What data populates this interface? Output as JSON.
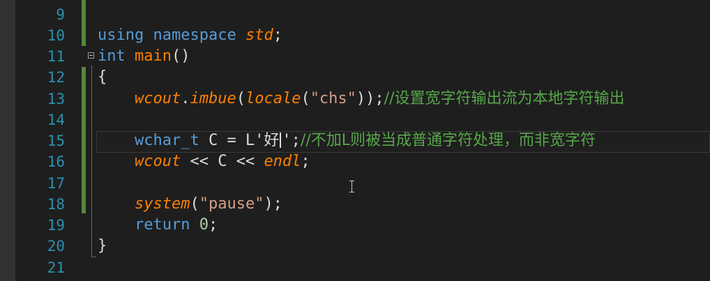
{
  "editor": {
    "language": "C++",
    "theme_colors": {
      "background": "#1e1e1e",
      "line_number": "#2b91af",
      "keyword": "#569cd6",
      "function": "#ff8000",
      "string": "#d69d85",
      "comment": "#57a64a",
      "number": "#b5cea8",
      "change_bar": "#55883a"
    },
    "current_line": 15,
    "lines": [
      {
        "number": "9"
      },
      {
        "number": "10",
        "t1": "using",
        "t2": " ",
        "t3": "namespace",
        "t4": " ",
        "t5": "std",
        "t6": ";"
      },
      {
        "number": "11",
        "t1": "int",
        "t2": " ",
        "t3": "main",
        "t4": "()"
      },
      {
        "number": "12",
        "t1": "{"
      },
      {
        "number": "13",
        "t1": "    ",
        "t2": "wcout",
        "t3": ".",
        "t4": "imbue",
        "t5": "(",
        "t6": "locale",
        "t7": "(",
        "t8": "\"chs\"",
        "t9": "));",
        "t10": "//设置宽字符输出流为本地字符输出"
      },
      {
        "number": "14"
      },
      {
        "number": "15",
        "t1": "    ",
        "t2": "wchar_t",
        "t3": " C = L'好",
        "t4": "';",
        "t5": "//不加L则被当成普通字符处理，而非宽字符"
      },
      {
        "number": "16",
        "t1": "    ",
        "t2": "wcout",
        "t3": " << C << ",
        "t4": "endl",
        "t5": ";"
      },
      {
        "number": "17"
      },
      {
        "number": "18",
        "t1": "    ",
        "t2": "system",
        "t3": "(",
        "t4": "\"pause\"",
        "t5": ");"
      },
      {
        "number": "19",
        "t1": "    ",
        "t2": "return",
        "t3": " ",
        "t4": "0",
        "t5": ";"
      },
      {
        "number": "20",
        "t1": "}"
      },
      {
        "number": "21"
      }
    ]
  }
}
